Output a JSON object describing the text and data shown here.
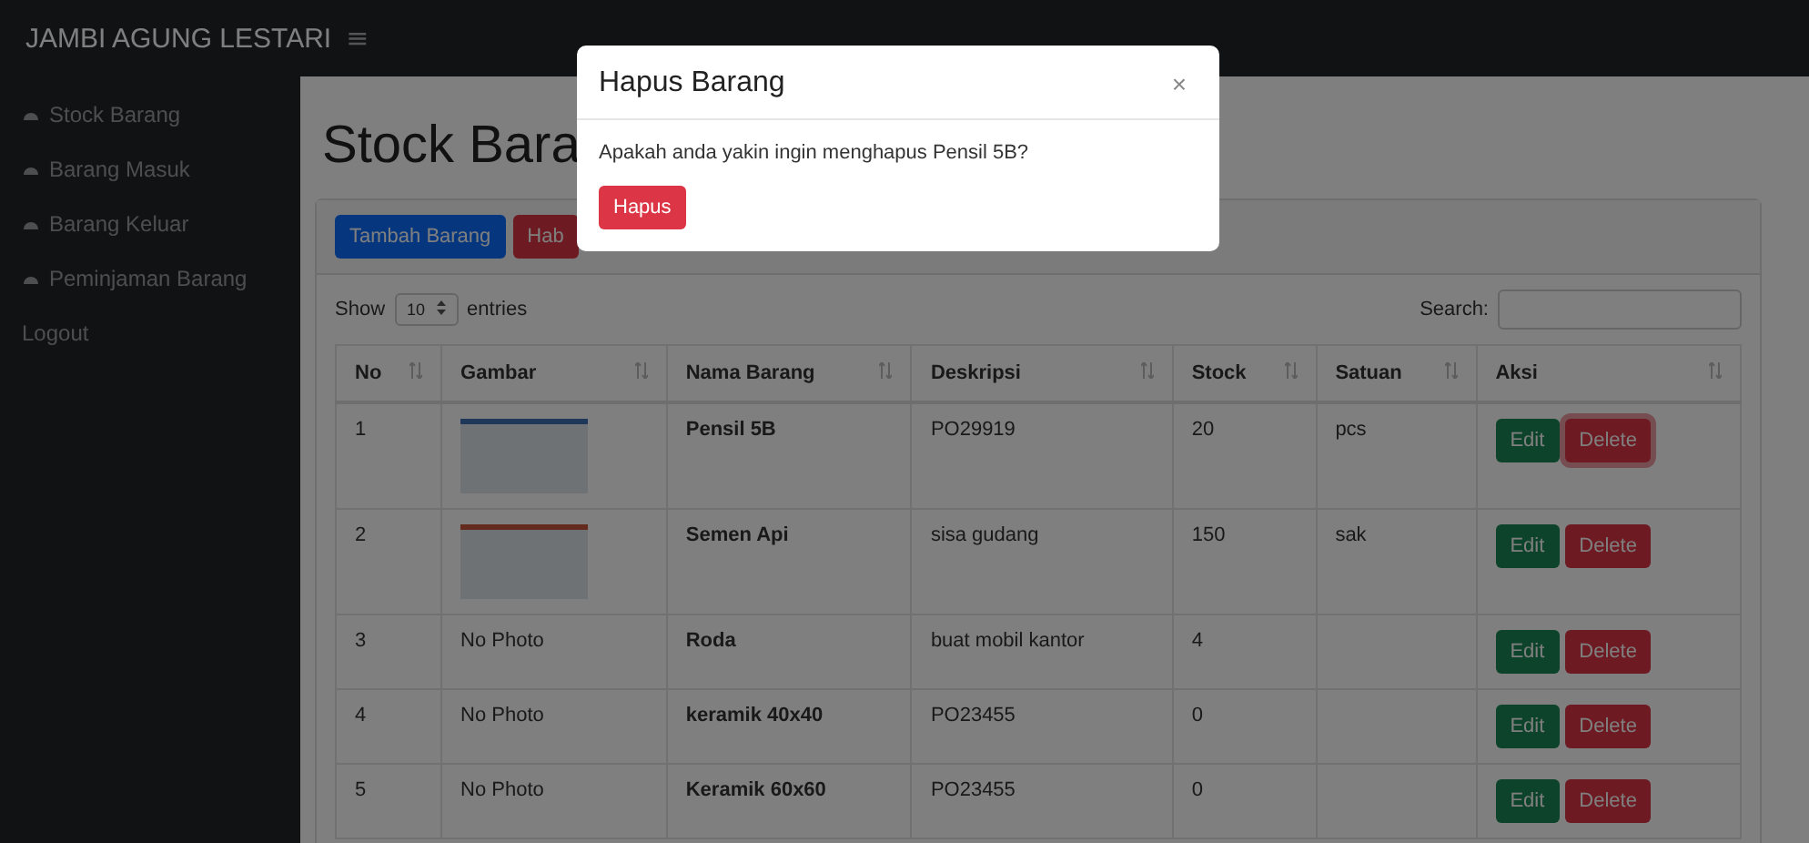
{
  "navbar": {
    "brand": "JAMBI AGUNG LESTARI",
    "menu_toggle": "≡"
  },
  "sidebar": {
    "items": [
      {
        "label": "Stock Barang",
        "icon": true
      },
      {
        "label": "Barang Masuk",
        "icon": true
      },
      {
        "label": "Barang Keluar",
        "icon": true
      },
      {
        "label": "Peminjaman Barang",
        "icon": true
      },
      {
        "label": "Logout",
        "icon": false
      }
    ]
  },
  "page": {
    "title": "Stock Bara",
    "buttons": [
      {
        "label": "Tambah Barang",
        "kind": "primary"
      },
      {
        "label": "Hab",
        "kind": "danger"
      }
    ]
  },
  "table_controls": {
    "show": "Show",
    "length": "10",
    "entries": "entries",
    "search_label": "Search:"
  },
  "table": {
    "columns": [
      "No",
      "Gambar",
      "Nama Barang",
      "Deskripsi",
      "Stock",
      "Satuan",
      "Aksi"
    ],
    "rows": [
      {
        "no": "1",
        "gambar": {
          "kind": "photo"
        },
        "nama": "Pensil 5B",
        "deskripsi": "PO29919",
        "stock": "20",
        "satuan": "pcs",
        "actions": [
          "Edit",
          "Delete"
        ],
        "focused": true
      },
      {
        "no": "2",
        "gambar": {
          "kind": "photo"
        },
        "nama": "Semen Api",
        "deskripsi": "sisa gudang",
        "stock": "150",
        "satuan": "sak",
        "actions": [
          "Edit",
          "Delete"
        ],
        "focused": false
      },
      {
        "no": "3",
        "gambar": {
          "kind": "text",
          "text": "No Photo"
        },
        "nama": "Roda",
        "deskripsi": "buat mobil kantor",
        "stock": "4",
        "actions": [
          "Edit",
          "Delete"
        ],
        "focused": false
      },
      {
        "no": "4",
        "gambar": {
          "kind": "text",
          "text": "No Photo"
        },
        "nama": "keramik 40x40",
        "deskripsi": "PO23455",
        "stock": "0",
        "actions": [
          "Edit",
          "Delete"
        ],
        "focused": false
      },
      {
        "no": "5",
        "gambar": {
          "kind": "text",
          "text": "No Photo"
        },
        "nama": "Keramik 60x60",
        "deskripsi": "PO23455",
        "stock": "0",
        "actions": [
          "Edit",
          "Delete"
        ],
        "focused": false
      }
    ]
  },
  "modal": {
    "title": "Hapus Barang",
    "close": "×",
    "message": "Apakah anda yakin ingin menghapus Pensil 5B?",
    "button": "Hapus"
  }
}
